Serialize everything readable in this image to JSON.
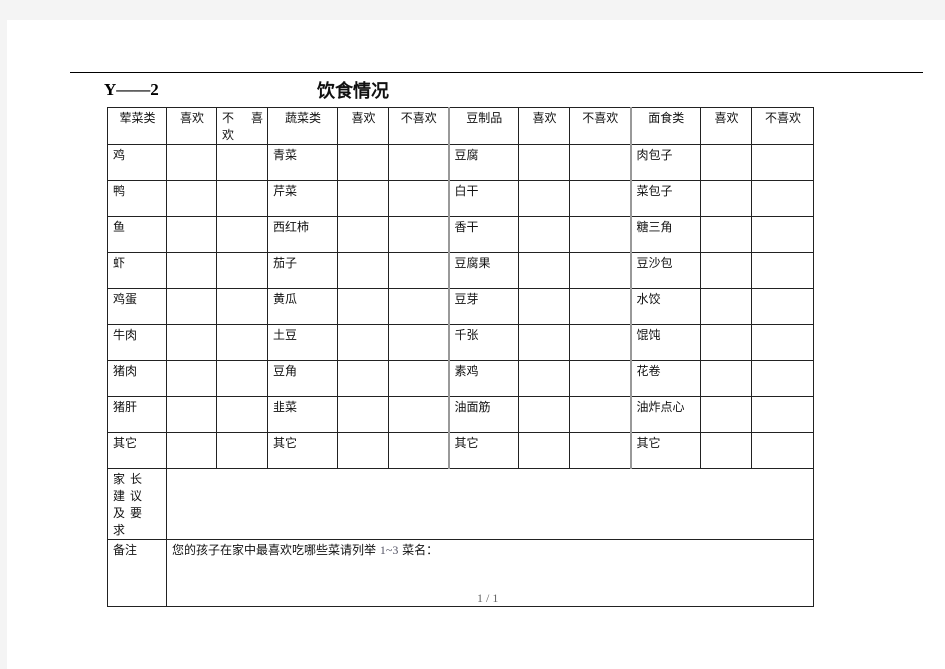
{
  "document": {
    "code": "Y——2",
    "title": "饮食情况",
    "page_indicator": "1 / 1"
  },
  "table": {
    "headers": {
      "meat": "荤菜类",
      "veg": "蔬菜类",
      "soy": "豆制品",
      "flour": "面食类",
      "like": "喜欢",
      "dislike": "不喜欢",
      "dislike_wrapped": "不 喜 欢"
    },
    "rows": [
      {
        "meat": "鸡",
        "veg": "青菜",
        "soy": "豆腐",
        "flour": "肉包子"
      },
      {
        "meat": "鸭",
        "veg": "芹菜",
        "soy": "白干",
        "flour": "菜包子"
      },
      {
        "meat": "鱼",
        "veg": "西红柿",
        "soy": "香干",
        "flour": "糖三角"
      },
      {
        "meat": "虾",
        "veg": "茄子",
        "soy": "豆腐果",
        "flour": "豆沙包"
      },
      {
        "meat": "鸡蛋",
        "veg": "黄瓜",
        "soy": "豆芽",
        "flour": "水饺"
      },
      {
        "meat": "牛肉",
        "veg": "土豆",
        "soy": "千张",
        "flour": "馄饨"
      },
      {
        "meat": "猪肉",
        "veg": "豆角",
        "soy": "素鸡",
        "flour": "花卷"
      },
      {
        "meat": "猪肝",
        "veg": "韭菜",
        "soy": "油面筋",
        "flour": "油炸点心"
      },
      {
        "meat": "其它",
        "veg": "其它",
        "soy": "其它",
        "flour": "其它"
      }
    ],
    "advice": {
      "label": "家长建议及要求",
      "value": ""
    },
    "note": {
      "label": "备注",
      "prompt_before": "您的孩子在家中最喜欢吃哪些菜请列举",
      "range": "1~3",
      "prompt_after": "菜名："
    }
  }
}
